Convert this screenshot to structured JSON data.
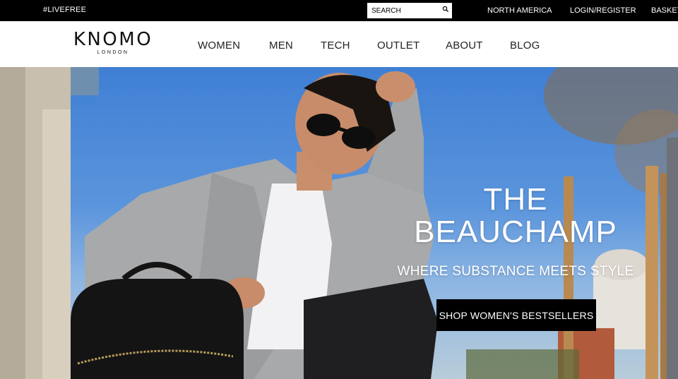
{
  "topbar": {
    "tagline": "#LIVEFREE",
    "search": {
      "placeholder": "SEARCH",
      "icon": "search-icon"
    },
    "links": [
      "NORTH AMERICA",
      "LOGIN/REGISTER",
      "BASKET"
    ]
  },
  "header": {
    "logo": {
      "brand": "KNOMO",
      "sub": "LONDON"
    },
    "nav": [
      "WOMEN",
      "MEN",
      "TECH",
      "OUTLET",
      "ABOUT",
      "BLOG"
    ]
  },
  "hero": {
    "title_line1": "THE",
    "title_line2": "BEAUCHAMP",
    "subtitle": "WHERE SUBSTANCE MEETS STYLE",
    "cta": "SHOP WOMEN'S BESTSELLERS"
  },
  "colors": {
    "topbar_bg": "#000000",
    "header_bg": "#ffffff",
    "cta_bg": "#000000",
    "hero_text": "#ffffff"
  }
}
